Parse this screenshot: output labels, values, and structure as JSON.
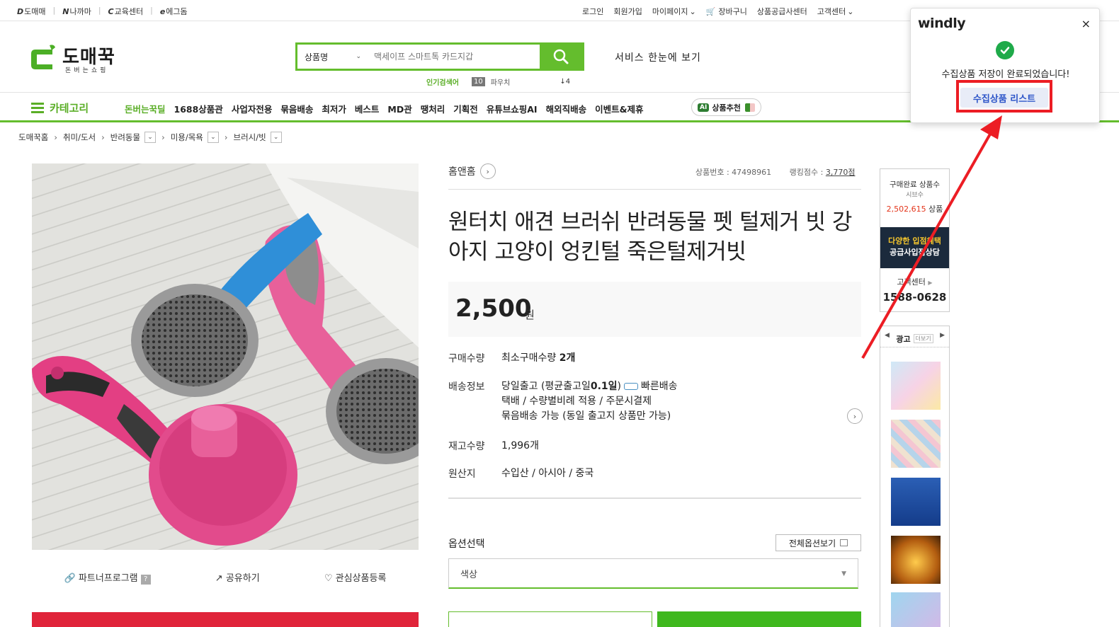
{
  "family_sites": [
    {
      "label": "도매매",
      "mark": "D"
    },
    {
      "label": "나까마",
      "mark": "N"
    },
    {
      "label": "교육센터",
      "mark": "C"
    },
    {
      "label": "에그돔",
      "mark": "e"
    }
  ],
  "util_menu": {
    "login": "로그인",
    "join": "회원가입",
    "mypage": "마이페이지",
    "cart": "장바구니",
    "supplier": "상품공급사센터",
    "cs": "고객센터"
  },
  "logo": {
    "name": "도매꾹",
    "sub": "돈버는쇼핑"
  },
  "search": {
    "category": "상품명",
    "placeholder": "맥세이프 스마트톡 카드지갑",
    "popular_label": "인기검색어",
    "popular_rank": "10",
    "popular_keyword": "파우치",
    "popular_delta": "↓4"
  },
  "service_all": "서비스 한눈에 보기",
  "nav": {
    "category": "카테고리",
    "items": [
      "돈버는꾹딜",
      "1688상품관",
      "사업자전용",
      "묶음배송",
      "최저가",
      "베스트",
      "MD관",
      "땡처리",
      "기획전",
      "유튜브쇼핑AI",
      "해외직배송",
      "이벤트&제휴"
    ],
    "ai_badge": "AI",
    "ai_label": "상품추천"
  },
  "breadcrumb": [
    "도매꾹홈",
    "취미/도서",
    "반려동물",
    "미용/목욕",
    "브러시/빗"
  ],
  "product": {
    "store": "홈앤홈",
    "number_label": "상품번호 : 47498961",
    "rank_label": "랭킹점수 : ",
    "rank_value": "3,770점",
    "title": "원터치 애견 브러쉬 반려동물 펫 털제거 빗 강아지 고양이 엉킨털 죽은털제거빗",
    "price": "2,500",
    "currency": "원",
    "qty_key": "구매수량",
    "qty_val_pre": "최소구매수량 ",
    "qty_val_bold": "2개",
    "ship_key": "배송정보",
    "ship_line1a": "당일출고 (평균출고일",
    "ship_line1b": "0.1일",
    "ship_line1c": ")",
    "ship_fast": "빠른배송",
    "ship_line2": "택배 / 수량별비례 적용 / 주문시결제",
    "ship_line3": "묶음배송 가능 (동일 출고지 상품만 가능)",
    "stock_key": "재고수량",
    "stock_val": "1,996개",
    "origin_key": "원산지",
    "origin_val": "수입산 / 아시아 / 중국",
    "option_label": "옵션선택",
    "all_options": "전체옵션보기",
    "option_select": "색상",
    "partner": "파트너프로그램",
    "partner_q": "?",
    "share": "공유하기",
    "wish": "관심상품등록"
  },
  "side": {
    "sold_label": "구매완료 상품수",
    "sold_sub": "시브수",
    "sold_value": "2,502,615",
    "sold_unit": " 상품",
    "banner_line1": "다양한 입점혜택",
    "banner_line2": "공급사입점상담",
    "cs_label": "고객센터",
    "cs_phone": "1588-0628",
    "ad_label": "광고",
    "ad_more": "더보기"
  },
  "popup": {
    "brand": "windly",
    "close": "×",
    "message": "수집상품 저장이 완료되었습니다!",
    "button": "수집상품 리스트"
  },
  "colors": {
    "brand_green": "#64bd2d",
    "popup_highlight": "#ec1d24",
    "success": "#1faa4a"
  }
}
